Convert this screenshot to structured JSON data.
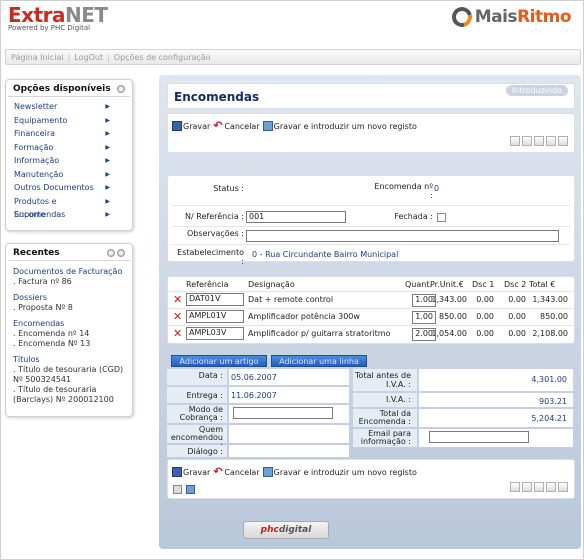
{
  "header": {
    "logo_main": "Extra",
    "logo_accent": "NET",
    "logo_sub": "Powered by PHC Digital",
    "brand_main": "Mais",
    "brand_accent": "Ritmo"
  },
  "menubar": {
    "items": [
      "Página Inicial",
      "LogOut",
      "Opções de configuração"
    ]
  },
  "left_panel": {
    "title": "Opções disponíveis",
    "items": [
      "Newsletter",
      "Equipamento",
      "Financeira",
      "Formação",
      "Informação",
      "Manutenção",
      "Outros Documentos",
      "Produtos e Encomendas",
      "Suporte"
    ]
  },
  "recent_panel": {
    "title": "Recentes",
    "groups": [
      {
        "name": "Documentos de Facturação",
        "items": [
          ". Factura nº 86"
        ]
      },
      {
        "name": "Dossiers",
        "items": [
          ". Proposta Nº 8"
        ]
      },
      {
        "name": "Encomendas",
        "items": [
          ". Encomenda nº 14",
          ". Encomenda Nº 13"
        ]
      },
      {
        "name": "Títulos",
        "items": [
          ". Título de tesouraria (CGD) Nº 500324541",
          ". Título de tesouraria (Barclays) Nº 200012100"
        ]
      }
    ]
  },
  "main": {
    "title": "Encomendas",
    "badge": "Introduzindo",
    "toolbar": {
      "save": "Gravar",
      "cancel": "Cancelar",
      "save_new": "Gravar e introduzir um novo registo"
    },
    "form": {
      "status_label": "Status :",
      "status_value": "",
      "encomenda_label": "Encomenda nº :",
      "encomenda_value": "0",
      "ref_label": "N/ Referência :",
      "ref_value": "001",
      "fechada_label": "Fechada :",
      "obs_label": "Observações :",
      "obs_value": "",
      "estab_label": "Estabelecimento :",
      "estab_value": "0 - Rua Circundante Bairro Municipal"
    },
    "grid": {
      "headers": [
        "Referência",
        "Designação",
        "Quant.",
        "Pr.Unit.€",
        "Dsc 1",
        "Dsc 2",
        "Total €"
      ],
      "rows": [
        {
          "ref": "DAT01V",
          "desig": "Dat + remote control",
          "qty": "1.00",
          "price": "1,343.00",
          "d1": "0.00",
          "d2": "0.00",
          "total": "1,343.00"
        },
        {
          "ref": "AMPL01V",
          "desig": "Amplificador potência 300w",
          "qty": "1.00",
          "price": "850.00",
          "d1": "0.00",
          "d2": "0.00",
          "total": "850.00"
        },
        {
          "ref": "AMPL03V",
          "desig": "Amplificador p/ guitarra stratoritmo",
          "qty": "2.00",
          "price": "1,054.00",
          "d1": "0.00",
          "d2": "0.00",
          "total": "2,108.00"
        }
      ]
    },
    "buttons": {
      "add_article": "Adicionar um artigo",
      "add_line": "Adicionar uma linha"
    },
    "totals": {
      "data_label": "Data :",
      "data_value": "05.06.2007",
      "entrega_label": "Entrega :",
      "entrega_value": "11.06.2007",
      "modo_label": "Modo de Cobrança :",
      "quem_label": "Quem encomendou :",
      "dialogo_label": "Diálogo :",
      "total_antes_label": "Total antes de I.V.A. :",
      "total_antes_value": "4,301.00",
      "iva_label": "I.V.A. :",
      "iva_value": "903.21",
      "total_label": "Total da Encomenda :",
      "total_value": "5,204.21",
      "email_label": "Email para informação :"
    }
  },
  "footer": {
    "logo_main": "phc",
    "logo_accent": "digital"
  }
}
